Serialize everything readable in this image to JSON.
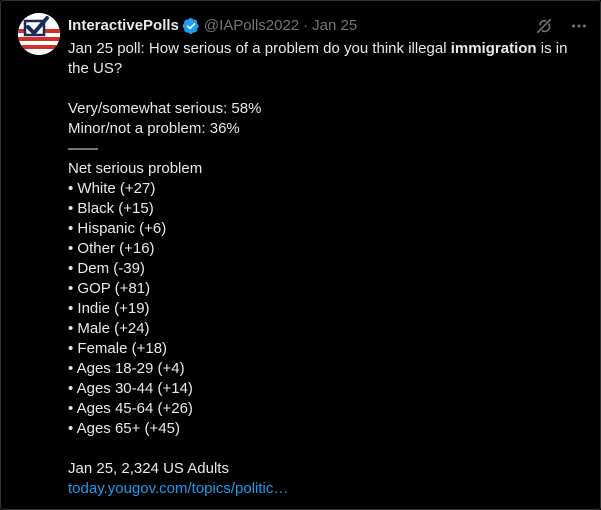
{
  "tweet": {
    "display_name": "InteractivePolls",
    "handle": "@IAPolls2022",
    "separator": "·",
    "date": "Jan 25",
    "verified_icon": "verified-badge-icon",
    "actions": {
      "grok_icon": "grok-icon",
      "more_icon": "more-icon"
    },
    "text": {
      "intro_prefix": "Jan 25 poll: How serious of a problem do you think illegal ",
      "intro_bold": "immigration",
      "intro_suffix": " is in the US?",
      "result_1": "Very/somewhat serious: 58%",
      "result_2": "Minor/not a problem: 36%",
      "divider": "——",
      "net_heading": "Net serious problem",
      "bullets": [
        "• White (+27)",
        "• Black (+15)",
        "• Hispanic (+6)",
        "• Other (+16)",
        "• Dem (-39)",
        "• GOP (+81)",
        "• Indie (+19)",
        "• Male (+24)",
        "• Female (+18)",
        "• Ages 18-29 (+4)",
        "• Ages 30-44 (+14)",
        "• Ages 45-64 (+26)",
        "• Ages 65+ (+45)"
      ],
      "footer": "Jan 25, 2,324 US Adults",
      "link": "today.yougov.com/topics/politic…"
    }
  },
  "colors": {
    "background": "#000000",
    "text": "#e7e9ea",
    "muted": "#71767b",
    "link": "#1d9bf0",
    "verified": "#1d9bf0"
  }
}
